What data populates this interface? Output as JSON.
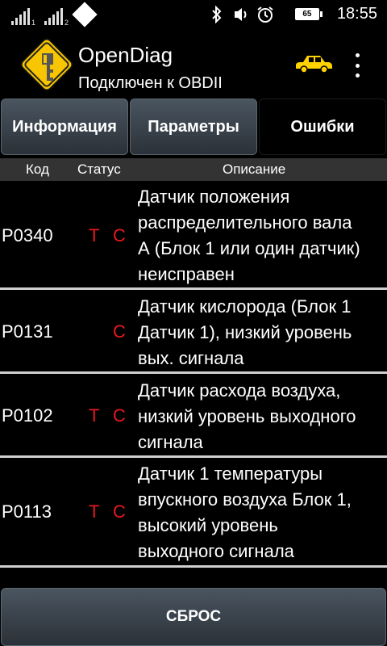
{
  "status_bar": {
    "time": "18:55",
    "battery_level": "65",
    "sim1_label": "1",
    "sim2_label": "2",
    "icons": [
      "signal-icon",
      "signal-icon",
      "data-diamond-icon",
      "bluetooth-icon",
      "vibrate-icon",
      "alarm-icon",
      "battery-icon"
    ]
  },
  "app_bar": {
    "title": "OpenDiag",
    "subtitle": "Подключен к OBDII",
    "logo_icon": "road-sign-key-icon",
    "car_icon": "car-icon",
    "menu_icon": "overflow-menu-icon",
    "colors": {
      "logo_yellow": "#f7c600",
      "car_yellow": "#ffd200"
    }
  },
  "tabs": [
    {
      "label": "Информация",
      "active": false
    },
    {
      "label": "Параметры",
      "active": false
    },
    {
      "label": "Ошибки",
      "active": true
    }
  ],
  "table": {
    "headers": {
      "code": "Код",
      "status": "Статус",
      "description": "Описание"
    },
    "rows": [
      {
        "code": "P0340",
        "status_t": "Т",
        "status_c": "С",
        "description": "Датчик положения\nраспределительного вала\nА (Блок 1 или один датчик)\nнеисправен"
      },
      {
        "code": "P0131",
        "status_t": "",
        "status_c": "С",
        "description": "Датчик кислорода (Блок 1\nДатчик 1), низкий уровень\nвых. сигнала"
      },
      {
        "code": "P0102",
        "status_t": "Т",
        "status_c": "С",
        "description": "Датчик расхода воздуха,\nнизкий уровень выходного\nсигнала"
      },
      {
        "code": "P0113",
        "status_t": "Т",
        "status_c": "С",
        "description": "Датчик 1 температуры\nвпускного воздуха Блок 1,\nвысокий уровень\nвыходного сигнала"
      }
    ],
    "colors": {
      "status_red": "#e8191b",
      "header_bg": "#333333"
    }
  },
  "reset_button": {
    "label": "СБРОС"
  }
}
